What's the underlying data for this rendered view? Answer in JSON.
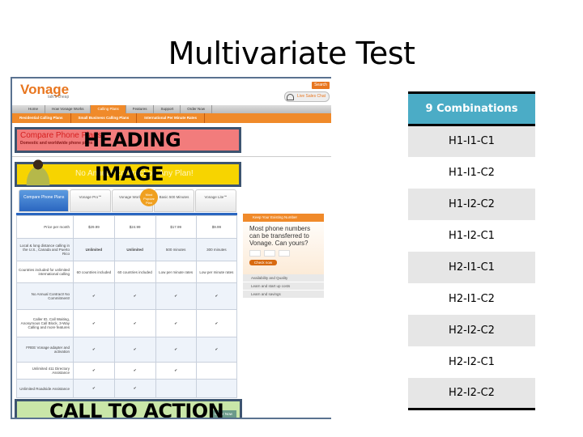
{
  "slide": {
    "title": "Multivariate Test"
  },
  "site": {
    "logo": "Vonage",
    "tagline": "talk's cheap",
    "search": "Search",
    "chat": "Live Sales Chat",
    "nav": [
      "Home",
      "How Vonage Works",
      "Calling Plans",
      "Features",
      "Support",
      "Order Now"
    ],
    "subnav": [
      "Residential Calling Plans",
      "Small Business Calling Plans",
      "International Per Minute Rates"
    ],
    "heading_text": "Compare Phone Plans",
    "heading_sub": "Domestic and worldwide phone plans",
    "heading_label": "HEADING",
    "image_text": "No Annual Contract on Any Plan!",
    "image_label": "IMAGE",
    "tabs": [
      "Compare Phone Plans",
      "Vonage Pro℠",
      "Vonage World℠",
      "Basic 500 Minutes",
      "Vonage Lite℠"
    ],
    "badge": "Most Popular Plan",
    "rows": [
      {
        "label": "Price per month",
        "cells": [
          "$29.99",
          "$24.99",
          "$17.99",
          "$9.99"
        ]
      },
      {
        "label": "Local & long distance calling in the U.S., Canada and Puerto Rico",
        "cells": [
          "Unlimited",
          "Unlimited",
          "500 minutes",
          "300 minutes"
        ]
      },
      {
        "label": "Countries included for unlimited international calling",
        "cells": [
          "60 countries included",
          "60 countries included",
          "Low per minute rates",
          "Low per minute rates"
        ]
      },
      {
        "label": "No Annual Contract! No Commitment!",
        "cells": [
          "✔",
          "✔",
          "✔",
          "✔"
        ]
      },
      {
        "label": "Caller ID, Call Waiting, Anonymous Call Block, 3-Way Calling and more features",
        "cells": [
          "✔",
          "✔",
          "✔",
          "✔"
        ]
      },
      {
        "label": "FREE Vonage adapter and activation",
        "cells": [
          "✔",
          "✔",
          "✔",
          "✔"
        ]
      },
      {
        "label": "Unlimited 411 Directory Assistance",
        "cells": [
          "✔",
          "✔",
          "✔",
          ""
        ]
      },
      {
        "label": "Unlimited Roadside Assistance",
        "cells": [
          "✔",
          "✔",
          "",
          ""
        ]
      }
    ],
    "side": {
      "header": "Keep Your Existing Number",
      "question": "Most phone numbers can be transferred to Vonage. Can yours?",
      "button": "Check now",
      "links": [
        "Availability and Quality",
        "Learn and start up costs",
        "Learn and savings"
      ]
    },
    "cta_label": "CALL TO ACTION",
    "cta_button": "Order Now"
  },
  "combinations": {
    "header": "9 Combinations",
    "rows": [
      "H1-I1-C1",
      "H1-I1-C2",
      "H1-I2-C2",
      "H1-I2-C1",
      "H2-I1-C1",
      "H2-I1-C2",
      "H2-I2-C2",
      "H2-I2-C1",
      "H2-I2-C2"
    ]
  },
  "colors": {
    "header": "#4bacc6",
    "heading_box": "#f27c7c",
    "image_box": "#f7d400",
    "cta_box": "#c9e6a8",
    "brand": "#e8761f"
  }
}
